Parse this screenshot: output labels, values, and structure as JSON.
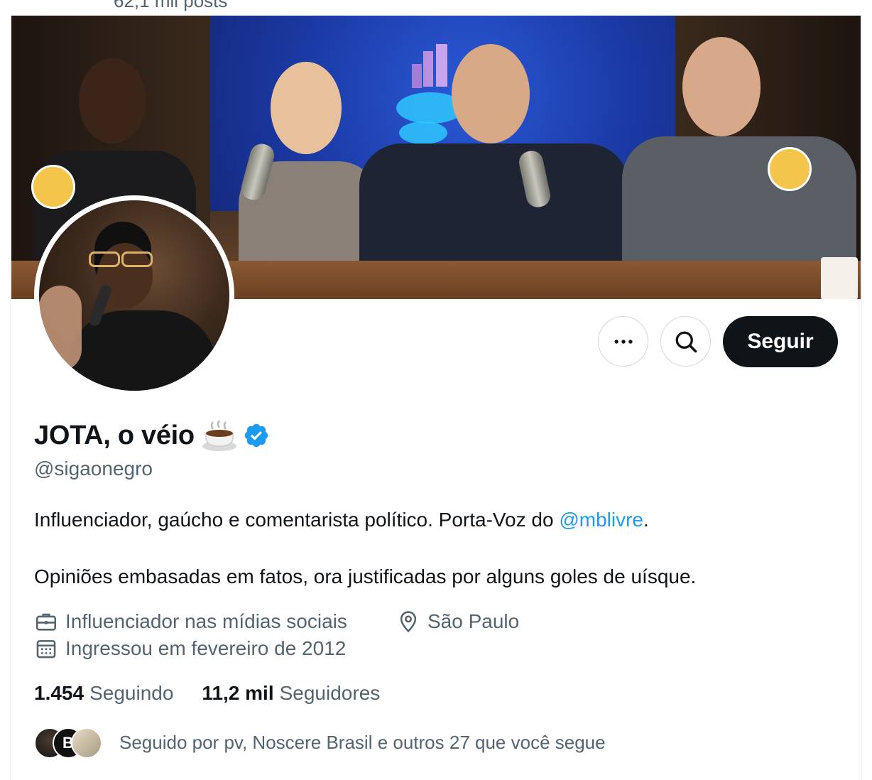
{
  "header": {
    "post_count": "62,1 mil posts"
  },
  "profile": {
    "display_name": "JOTA, o véio",
    "name_emoji": "coffee-cup-icon",
    "verified": true,
    "handle": "@sigaonegro",
    "bio_line1_prefix": "Influenciador, gaúcho e comentarista político. Porta-Voz do ",
    "bio_line1_link": "@mblivre",
    "bio_line1_suffix": ".",
    "bio_line2": "Opiniões embasadas em fatos, ora justificadas por alguns goles de uísque.",
    "category": "Influenciador nas mídias sociais",
    "location": "São Paulo",
    "joined": "Ingressou em fevereiro de 2012",
    "following_count": "1.454",
    "following_label": "Seguindo",
    "followers_count": "11,2 mil",
    "followers_label": "Seguidores",
    "followed_by": "Seguido por pv, Noscere Brasil e outros 27 que você segue",
    "mini_avatar_letter": "B"
  },
  "actions": {
    "follow_label": "Seguir",
    "more_icon": "more-icon",
    "search_icon": "search-icon"
  },
  "colors": {
    "link": "#1d9bf0",
    "secondary_text": "#536471",
    "primary_text": "#0f1419",
    "follow_button_bg": "#0f1419",
    "verified": "#1d9bf0"
  }
}
